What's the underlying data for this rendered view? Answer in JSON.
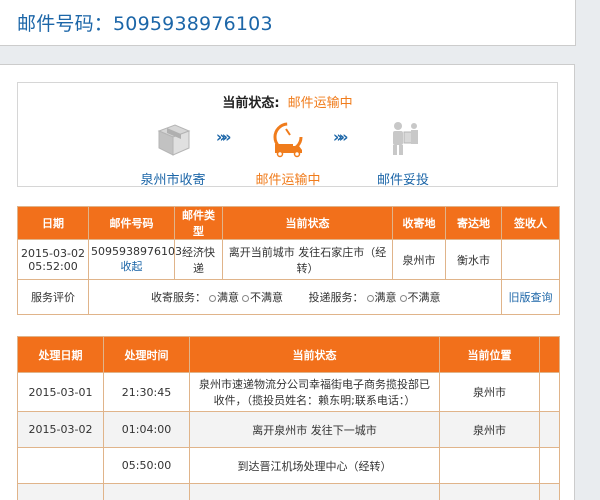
{
  "header": {
    "title": "邮件号码：5095938976103"
  },
  "status": {
    "label": "当前状态:",
    "value": "邮件运输中",
    "steps": [
      {
        "label": "泉州市收寄",
        "icon": "package-icon",
        "active": false
      },
      {
        "label": "邮件运输中",
        "icon": "truck-icon",
        "active": true
      },
      {
        "label": "邮件妥投",
        "icon": "delivery-person-icon",
        "active": false
      }
    ],
    "arrow": "»»"
  },
  "summary_table": {
    "headers": [
      "日期",
      "邮件号码",
      "邮件类型",
      "当前状态",
      "收寄地",
      "寄达地",
      "签收人"
    ],
    "row": {
      "date": "2015-03-02 05:52:00",
      "number": "5095938976103",
      "collapse_link": "收起",
      "type": "经济快递",
      "status": "离开当前城市 发往石家庄市（经转）",
      "origin": "泉州市",
      "destination": "衡水市",
      "signer": ""
    },
    "evaluation": {
      "label": "服务评价",
      "pickup_label": "收寄服务：",
      "delivery_label": "投递服务：",
      "satisfied": "满意",
      "unsatisfied": "不满意",
      "old_query_link": "旧版查询"
    }
  },
  "detail_table": {
    "headers": [
      "处理日期",
      "处理时间",
      "当前状态",
      "当前位置"
    ],
    "rows": [
      {
        "date": "2015-03-01",
        "time": "21:30:45",
        "status": "泉州市速递物流分公司幸福街电子商务揽投部已收件，（揽投员姓名：赖东明;联系电话：）",
        "location": "泉州市"
      },
      {
        "date": "2015-03-02",
        "time": "01:04:00",
        "status": "离开泉州市 发往下一城市",
        "location": "泉州市"
      },
      {
        "date": "",
        "time": "05:50:00",
        "status": "到达晋江机场处理中心（经转）",
        "location": ""
      }
    ]
  },
  "colors": {
    "accent": "#f2701b",
    "link": "#1c66a8",
    "active_step": "#f07c1c"
  }
}
